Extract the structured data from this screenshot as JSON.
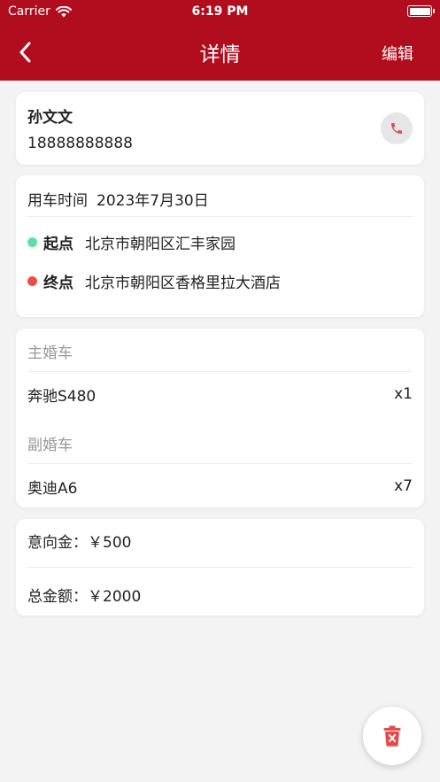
{
  "status_bar": {
    "carrier": "Carrier",
    "time": "6:19 PM"
  },
  "nav": {
    "title": "详情",
    "edit_label": "编辑"
  },
  "contact": {
    "name": "孙文文",
    "phone": "18888888888"
  },
  "trip": {
    "time_label": "用车时间",
    "date": "2023年7月30日",
    "start_label": "起点",
    "start_address": "北京市朝阳区汇丰家园",
    "end_label": "终点",
    "end_address": "北京市朝阳区香格里拉大酒店"
  },
  "cars": {
    "main_heading": "主婚车",
    "main_name": "奔驰S480",
    "main_qty": "x1",
    "sub_heading": "副婚车",
    "sub_name": "奥迪A6",
    "sub_qty": "x7"
  },
  "payment": {
    "deposit": "意向金：￥500",
    "total": "总金额：￥2000"
  },
  "colors": {
    "header": "#b10d1f",
    "start_dot": "#5ee0a0",
    "end_dot": "#f04a4a",
    "accent": "#e54b4b"
  }
}
